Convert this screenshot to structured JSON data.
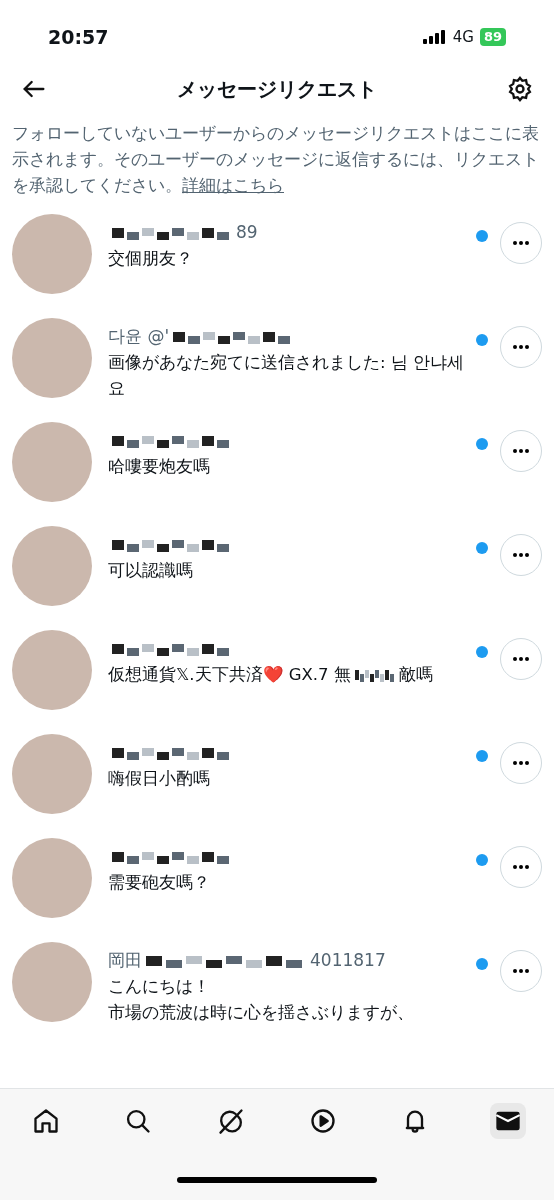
{
  "status_bar": {
    "time": "20:57",
    "network": "4G",
    "battery": "89"
  },
  "header": {
    "title": "メッセージリクエスト"
  },
  "notice": {
    "text": "フォローしていないユーザーからのメッセージリクエストはここに表示されます。そのユーザーのメッセージに返信するには、リクエストを承認してください。",
    "link": "詳細はこちら"
  },
  "requests": [
    {
      "name_after": "89",
      "message_lines": [
        "交個朋友？"
      ],
      "unread": true
    },
    {
      "name_before": "다윤 @'",
      "message_lines": [
        "画像があなた宛てに送信されました: 님 안냐세요"
      ],
      "unread": true
    },
    {
      "message_lines": [
        "哈嘍要炮友嗎"
      ],
      "unread": true
    },
    {
      "message_lines": [
        "可以認識嗎"
      ],
      "unread": true
    },
    {
      "message_lines": [
        "仮想通貨𝕏.天下共済❤️ GX.7 無"
      ],
      "message_tail": "敵嗎",
      "unread": true
    },
    {
      "message_lines": [
        "嗨假日小酌嗎"
      ],
      "unread": true
    },
    {
      "message_lines": [
        "需要砲友嗎？"
      ],
      "unread": true
    },
    {
      "name_before": "岡田",
      "name_after": "4011817",
      "message_lines": [
        "こんにちは！",
        "市場の荒波は時に心を揺さぶりますが、"
      ],
      "unread": true
    }
  ],
  "nav": [
    {
      "kind": "home",
      "selected": false
    },
    {
      "kind": "search",
      "selected": false
    },
    {
      "kind": "grok",
      "selected": false
    },
    {
      "kind": "video",
      "selected": false
    },
    {
      "kind": "bell",
      "selected": false
    },
    {
      "kind": "mail",
      "selected": true
    }
  ]
}
